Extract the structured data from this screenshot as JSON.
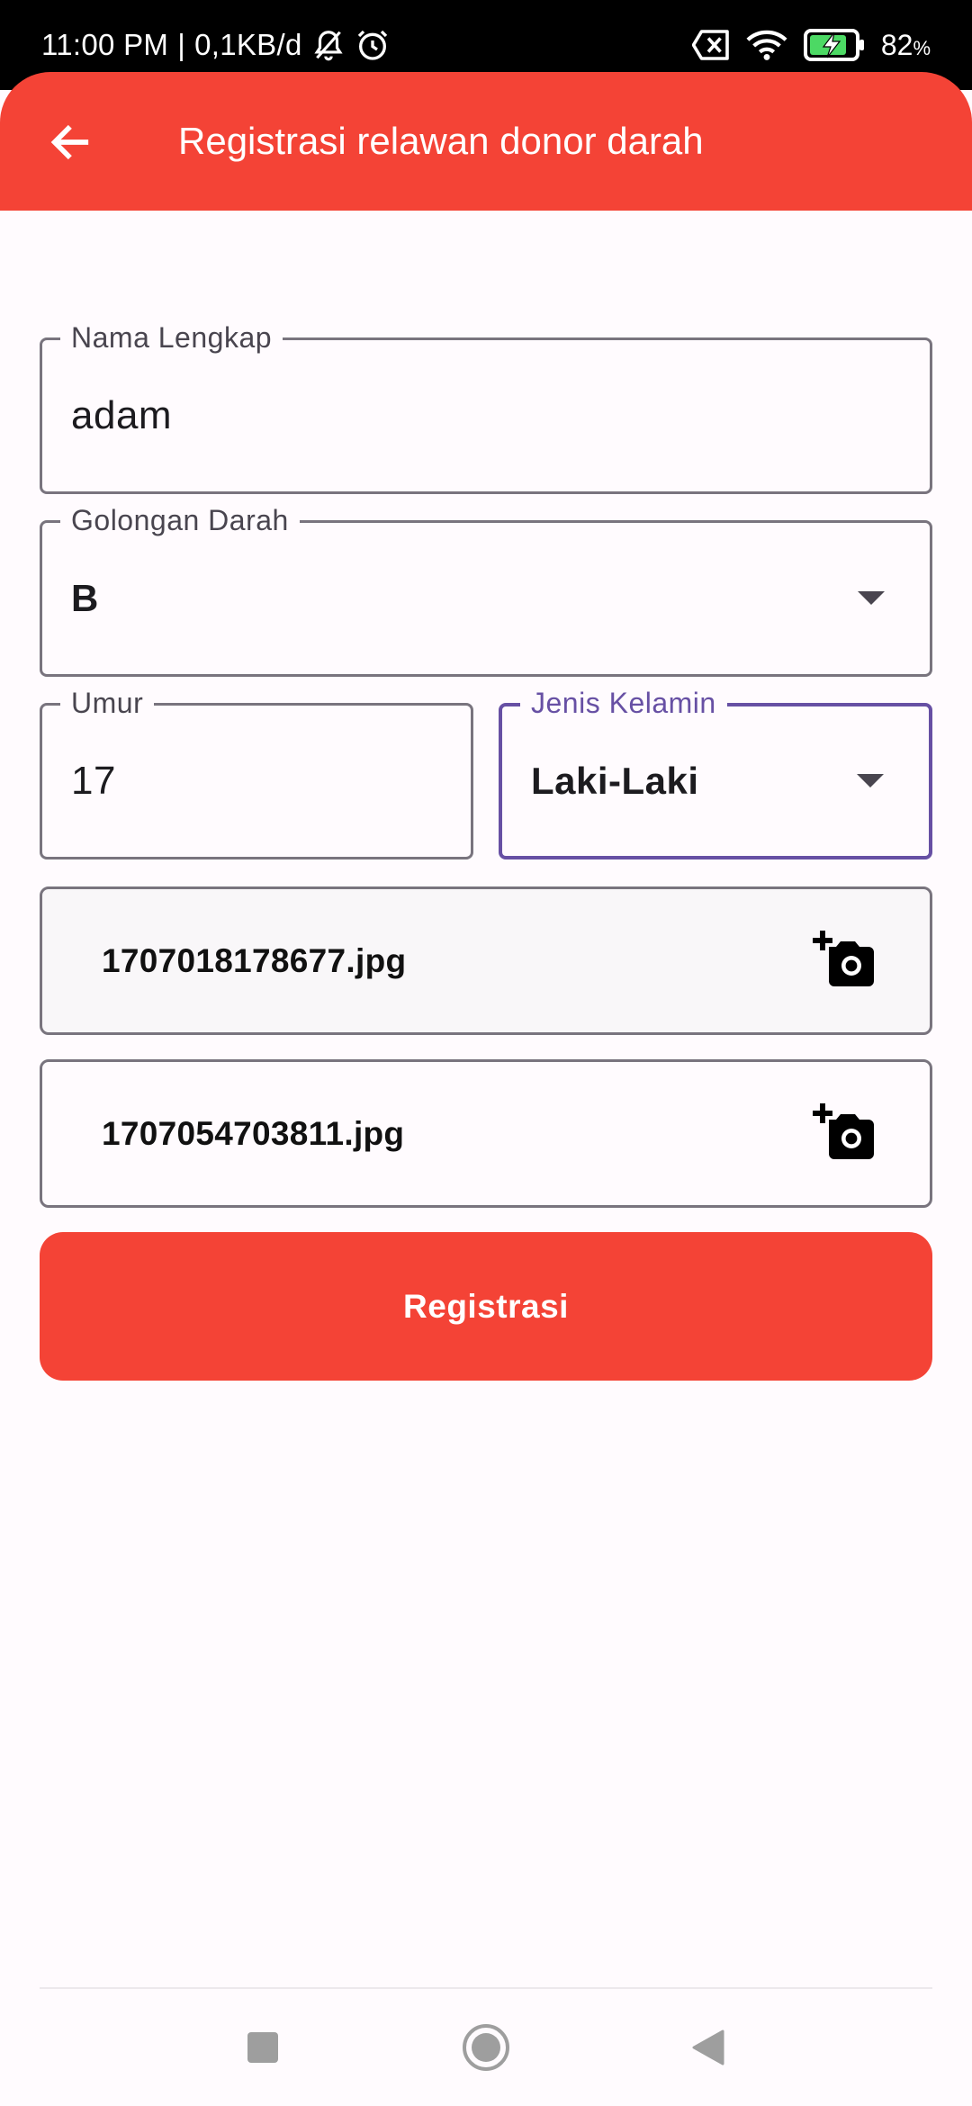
{
  "status_bar": {
    "time": "11:00 PM",
    "separator": "|",
    "network_speed": "0,1KB/d",
    "battery_percent": "82",
    "battery_unit": "%"
  },
  "app_bar": {
    "title": "Registrasi relawan donor darah"
  },
  "form": {
    "nama_lengkap": {
      "label": "Nama Lengkap",
      "value": "adam"
    },
    "golongan_darah": {
      "label": "Golongan Darah",
      "value": "B"
    },
    "umur": {
      "label": "Umur",
      "value": "17"
    },
    "jenis_kelamin": {
      "label": "Jenis Kelamin",
      "value": "Laki-Laki"
    },
    "photo_1": {
      "filename": "1707018178677.jpg"
    },
    "photo_2": {
      "filename": "1707054703811.jpg"
    },
    "submit_label": "Registrasi"
  },
  "colors": {
    "primary": "#f44336",
    "focus": "#6750a4",
    "outline": "#79747e",
    "background": "#fffbfe"
  },
  "icons": {
    "back": "arrow-left-icon",
    "camera": "add-a-photo-icon",
    "dropdown": "arrow-drop-down-icon",
    "nav_recents": "square-icon",
    "nav_home": "circle-icon",
    "nav_back": "triangle-left-icon"
  }
}
